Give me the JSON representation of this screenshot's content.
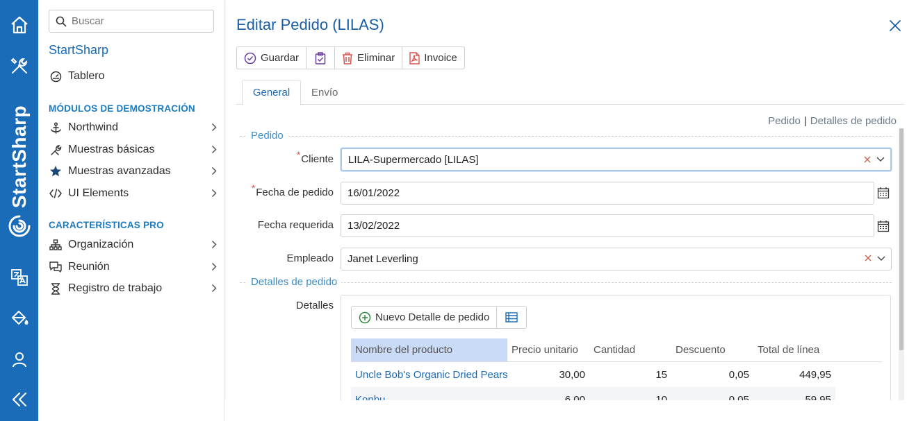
{
  "rail": {
    "brand": "StartSharp",
    "icons": [
      "home-icon",
      "tools-icon",
      "translate-icon",
      "paint-bucket-icon",
      "user-icon",
      "collapse-icon"
    ],
    "bg": "#1a6bb8"
  },
  "nav": {
    "search_placeholder": "Buscar",
    "brand": "StartSharp",
    "dashboard": "Tablero",
    "section_demo": "MÓDULOS DE DEMOSTRACIÓN",
    "demo_items": [
      {
        "label": "Northwind",
        "icon": "anchor-icon"
      },
      {
        "label": "Muestras básicas",
        "icon": "wrench-icon"
      },
      {
        "label": "Muestras avanzadas",
        "icon": "star-icon"
      },
      {
        "label": "UI Elements",
        "icon": "code-icon"
      }
    ],
    "section_pro": "CARACTERÍSTICAS PRO",
    "pro_items": [
      {
        "label": "Organización",
        "icon": "sitemap-icon"
      },
      {
        "label": "Reunión",
        "icon": "chat-icon"
      },
      {
        "label": "Registro de trabajo",
        "icon": "hourglass-icon"
      }
    ]
  },
  "dialog": {
    "title": "Editar Pedido (LILAS)",
    "toolbar": {
      "save": "Guardar",
      "delete": "Eliminar",
      "invoice": "Invoice"
    },
    "tabs": {
      "general": "General",
      "shipping": "Envío"
    },
    "crumbs": {
      "order": "Pedido",
      "details": "Detalles de pedido"
    },
    "section_order": "Pedido",
    "section_details": "Detalles de pedido",
    "fields": {
      "customer_label": "Cliente",
      "customer_value": "LILA-Supermercado [LILAS]",
      "order_date_label": "Fecha de pedido",
      "order_date_value": "16/01/2022",
      "required_date_label": "Fecha requerida",
      "required_date_value": "13/02/2022",
      "employee_label": "Empleado",
      "employee_value": "Janet Leverling",
      "details_label": "Detalles"
    },
    "details": {
      "new_button": "Nuevo Detalle de pedido",
      "columns": [
        "Nombre del producto",
        "Precio unitario",
        "Cantidad",
        "Descuento",
        "Total de línea"
      ],
      "rows": [
        {
          "product": "Uncle Bob's Organic Dried Pears",
          "price": "30,00",
          "qty": "15",
          "discount": "0,05",
          "total": "449,95"
        },
        {
          "product": "Konbu",
          "price": "6,00",
          "qty": "10",
          "discount": "0,05",
          "total": "59,95"
        }
      ]
    }
  },
  "colors": {
    "accent": "#1a6bb8",
    "section": "#3b8fc8",
    "required": "#d9534f",
    "delete": "#d9534f",
    "sorted_header": "#c9dbf7"
  }
}
